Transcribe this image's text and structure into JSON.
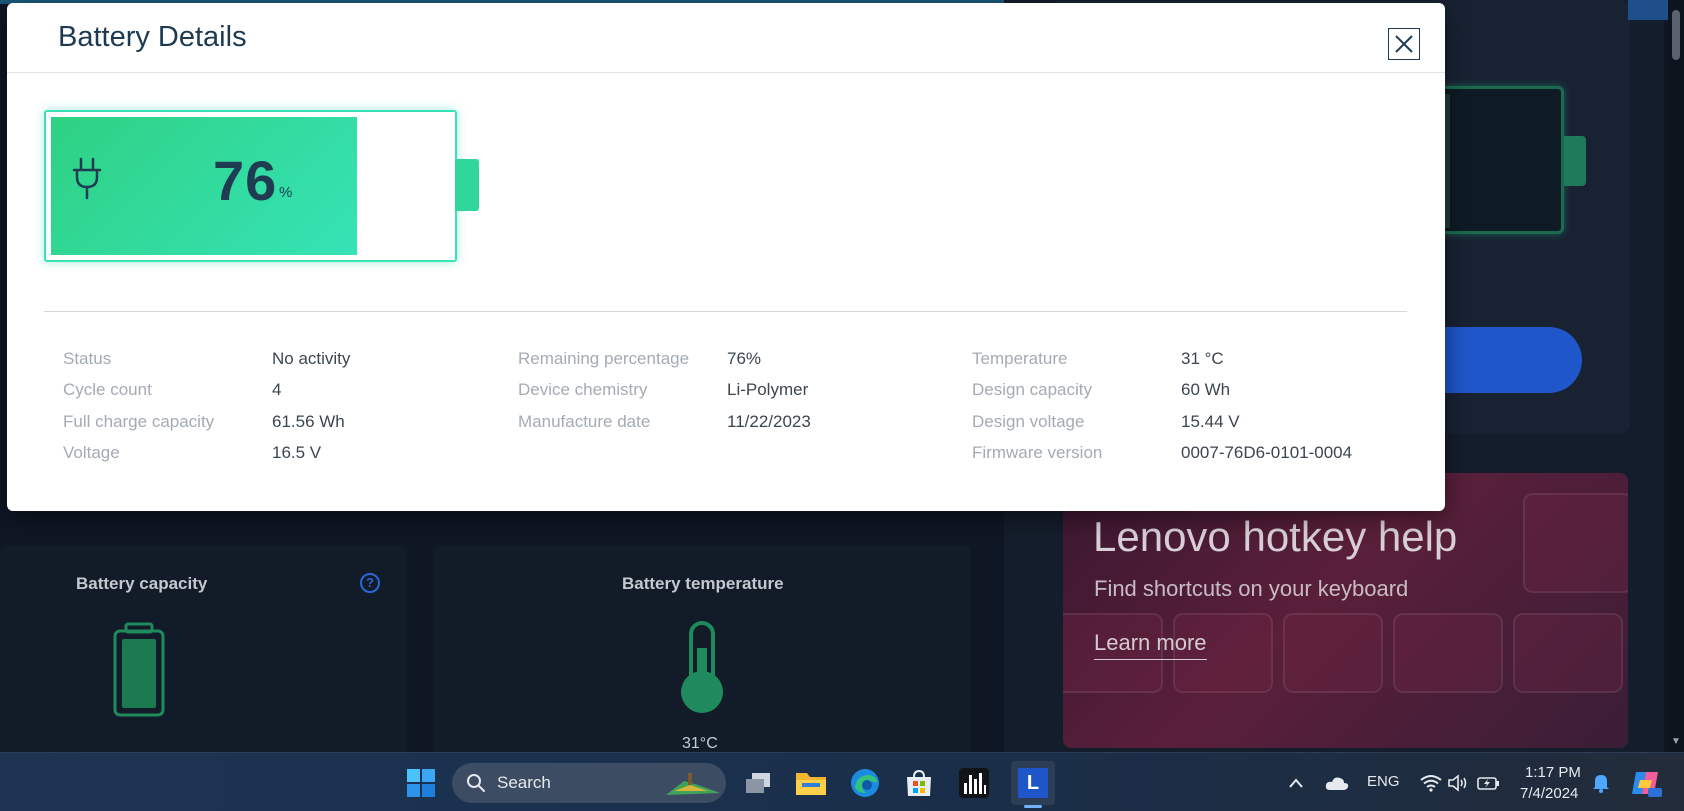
{
  "modal": {
    "title": "Battery Details",
    "battery": {
      "percent": "76",
      "percent_sign": "%",
      "level": 0.76
    },
    "details": {
      "col1": [
        {
          "label": "Status",
          "value": "No activity"
        },
        {
          "label": "Cycle count",
          "value": "4"
        },
        {
          "label": "Full charge capacity",
          "value": "61.56 Wh"
        },
        {
          "label": "Voltage",
          "value": "16.5 V"
        }
      ],
      "col2": [
        {
          "label": "Remaining percentage",
          "value": "76%"
        },
        {
          "label": "Device chemistry",
          "value": "Li-Polymer"
        },
        {
          "label": "Manufacture date",
          "value": "11/22/2023"
        }
      ],
      "col3": [
        {
          "label": "Temperature",
          "value": "31 °C"
        },
        {
          "label": "Design capacity",
          "value": "60 Wh"
        },
        {
          "label": "Design voltage",
          "value": "15.44 V"
        },
        {
          "label": "Firmware version",
          "value": "0007-76D6-0101-0004"
        }
      ]
    }
  },
  "background": {
    "battery_capacity_title": "Battery capacity",
    "battery_temperature_title": "Battery temperature",
    "temperature_value": "31°C",
    "promo": {
      "title": "Lenovo hotkey help",
      "subtitle": "Find shortcuts on your keyboard",
      "link": "Learn more"
    }
  },
  "taskbar": {
    "search_label": "Search",
    "language": "ENG",
    "time": "1:17 PM",
    "date": "7/4/2024",
    "lenovo_app_letter": "L"
  },
  "colors": {
    "battery_green": "#2ed183",
    "battery_cyan": "#36e3b6",
    "title_navy": "#1e3a52",
    "label_gray": "#a4abb3",
    "value_dark": "#3c4650",
    "accent_blue": "#1f56c9"
  }
}
